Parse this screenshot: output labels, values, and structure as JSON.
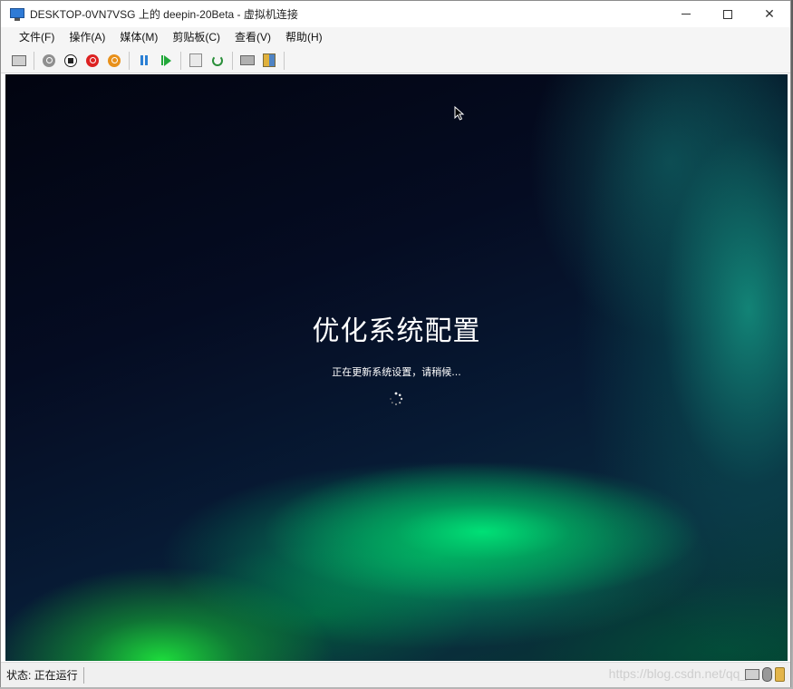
{
  "window": {
    "title": "DESKTOP-0VN7VSG 上的 deepin-20Beta - 虚拟机连接",
    "icon": "vm-connection-icon",
    "controls": [
      "minimize-icon",
      "maximize-icon",
      "close-icon"
    ],
    "close_glyph": "✕"
  },
  "menubar": {
    "items": [
      "文件(F)",
      "操作(A)",
      "媒体(M)",
      "剪贴板(C)",
      "查看(V)",
      "帮助(H)"
    ]
  },
  "toolbar": {
    "icons": [
      "ctrl-alt-del-icon",
      "start-icon",
      "turn-off-icon",
      "shut-down-icon",
      "save-icon",
      "pause-icon",
      "resume-icon",
      "checkpoint-icon",
      "revert-icon",
      "enhanced-session-icon",
      "share-icon"
    ]
  },
  "vm_screen": {
    "title": "优化系统配置",
    "subtitle": "正在更新系统设置，请稍候...",
    "spinner_icon": "loading-spinner-icon",
    "cursor_icon": "mouse-cursor-icon"
  },
  "statusbar": {
    "status": "状态: 正在运行",
    "watermark": "https://blog.csdn.net/qq_3",
    "icons": [
      "keyboard-icon",
      "mouse-icon",
      "lock-icon"
    ]
  },
  "colors": {
    "accent_blue": "#2a7fd4",
    "accent_green": "#22a83a",
    "stop_red": "#dd2222",
    "save_orange": "#e8901a"
  }
}
